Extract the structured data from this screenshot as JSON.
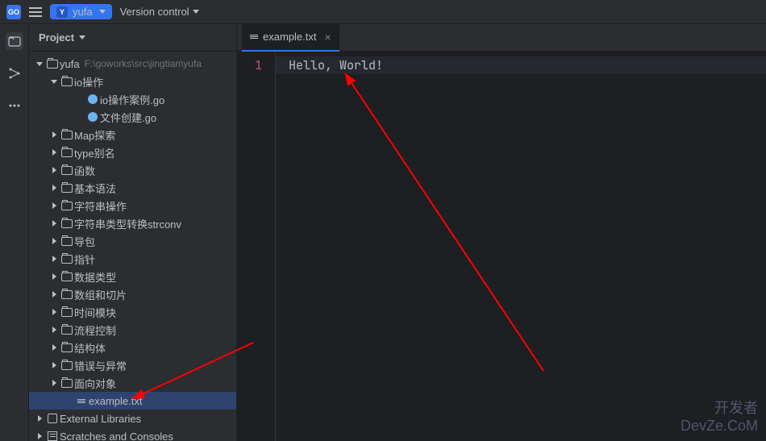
{
  "topbar": {
    "ide_badge": "GO",
    "project_badge": "Y",
    "project_name": "yufa",
    "vcs_label": "Version control"
  },
  "sidebar": {
    "header": "Project",
    "root": {
      "label": "yufa",
      "hint": "F:\\goworks\\src\\jingtian\\yufa"
    },
    "io_folder": "io操作",
    "io_files": [
      "io操作案例.go",
      "文件创建.go"
    ],
    "folders": [
      "Map探索",
      "type别名",
      "函数",
      "基本语法",
      "字符串操作",
      "字符串类型转换strconv",
      "导包",
      "指针",
      "数据类型",
      "数组和切片",
      "时间模块",
      "流程控制",
      "结构体",
      "错误与异常",
      "面向对象"
    ],
    "selected_file": "example.txt",
    "external_libs": "External Libraries",
    "scratches": "Scratches and Consoles"
  },
  "editor": {
    "tab_name": "example.txt",
    "line_number": "1",
    "content": "Hello, World!"
  },
  "watermark": {
    "line1": "开发者",
    "line2": "DevZe.CoM"
  }
}
